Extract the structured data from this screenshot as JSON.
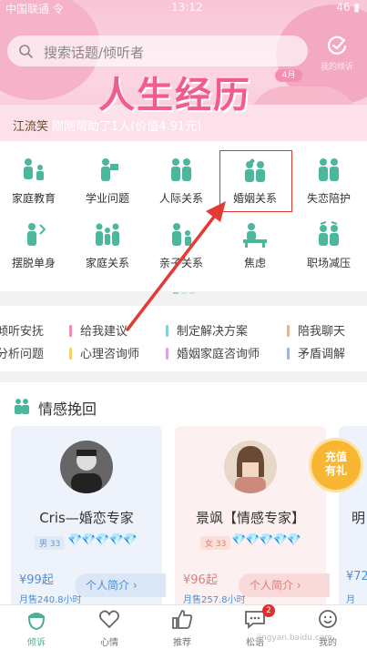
{
  "status": {
    "left": "中国联通 令",
    "time": "13:12",
    "right": "46 ▮"
  },
  "search": {
    "placeholder": "搜索话题/倾听者"
  },
  "banner": {
    "action_label": "我的倾诉",
    "headline": "人生经历",
    "month": "4月",
    "notice_user": "江流笑",
    "notice_text": "刚刚帮助了1人(价值4.91元)"
  },
  "categories": [
    {
      "label": "家庭教育",
      "icon": "family-education-icon"
    },
    {
      "label": "学业问题",
      "icon": "study-icon"
    },
    {
      "label": "人际关系",
      "icon": "relationship-icon"
    },
    {
      "label": "婚姻关系",
      "icon": "marriage-icon"
    },
    {
      "label": "失恋陪护",
      "icon": "breakup-icon"
    },
    {
      "label": "摆脱单身",
      "icon": "single-icon"
    },
    {
      "label": "家庭关系",
      "icon": "family-relation-icon"
    },
    {
      "label": "亲子关系",
      "icon": "parent-child-icon"
    },
    {
      "label": "焦虑",
      "icon": "anxiety-icon"
    },
    {
      "label": "职场减压",
      "icon": "workplace-icon"
    }
  ],
  "services": [
    {
      "label": "倾听安抚",
      "color": "#f28b8b"
    },
    {
      "label": "给我建议",
      "color": "#f28bb0"
    },
    {
      "label": "制定解决方案",
      "color": "#7fd3d3"
    },
    {
      "label": "陪我聊天",
      "color": "#f6b27a"
    },
    {
      "label": "分析问题",
      "color": "#9ec3ef"
    },
    {
      "label": "心理咨询师",
      "color": "#f6d36a"
    },
    {
      "label": "婚姻家庭咨询师",
      "color": "#d7a3e6"
    },
    {
      "label": "矛盾调解",
      "color": "#8fb9f0"
    }
  ],
  "section": {
    "title": "情感挽回"
  },
  "experts": [
    {
      "name": "Cris—婚恋专家",
      "badge": "男 33",
      "gems": "💎💎💎💎💎",
      "price": "¥99起",
      "sold": "月售240.8小时",
      "intro": "个人简介 ›",
      "bg": "#eef3fb",
      "accent": "#4a90d9"
    },
    {
      "name": "景飒【情感专家】",
      "badge": "女 33",
      "gems": "💎💎💎💎💎",
      "price": "¥96起",
      "sold": "月售257.8小时",
      "intro": "个人简介 ›",
      "bg": "#fdf0f0",
      "accent": "#e07c7c"
    },
    {
      "name": "明",
      "price": "¥72",
      "sold": "月"
    }
  ],
  "promo": {
    "line1": "充值",
    "line2": "有礼"
  },
  "tabs": [
    {
      "label": "倾诉"
    },
    {
      "label": "心情"
    },
    {
      "label": "推荐"
    },
    {
      "label": "松语",
      "badge": "2"
    },
    {
      "label": "我的"
    }
  ],
  "watermark": "jingyan.baidu.com"
}
